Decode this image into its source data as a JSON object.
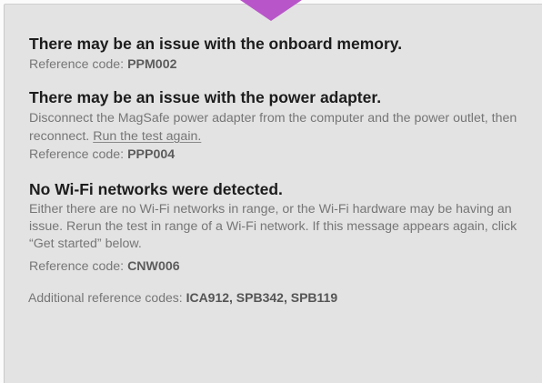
{
  "colors": {
    "pointer": "#b856c9",
    "panel_background": "#e3e3e3",
    "title_text": "#1c1c1c",
    "body_text": "#767676"
  },
  "pointer": {
    "icon": "triangle-pointer-icon"
  },
  "issues": [
    {
      "title": "There may be an issue with the onboard memory.",
      "description": "",
      "reference_label": "Reference code: ",
      "reference_code": "PPM002"
    },
    {
      "title": "There may be an issue with the power adapter.",
      "description": "Disconnect the MagSafe power adapter from the computer and the power outlet, then reconnect. ",
      "link_text": "Run the test again.",
      "reference_label": "Reference code: ",
      "reference_code": "PPP004"
    },
    {
      "title": "No Wi-Fi networks were detected.",
      "description": "Either there are no Wi-Fi networks in range, or the Wi-Fi hardware may be having an issue. Rerun the test in range of a Wi-Fi network. If this message appears again, click “Get started” below.",
      "reference_label": "Reference code: ",
      "reference_code": "CNW006"
    }
  ],
  "additional": {
    "label": "Additional reference codes: ",
    "codes": "ICA912, SPB342, SPB119"
  }
}
